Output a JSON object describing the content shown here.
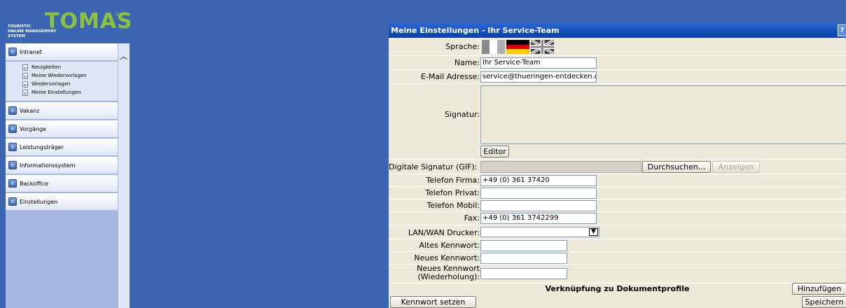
{
  "logo": {
    "wordmark": "TOMAS",
    "registered": "®",
    "tagline": "TOURISTIC\nONLINE MANAGEMENT\nSYSTEM"
  },
  "sidebar": {
    "scroll_up_icon": "chevron-up-icon",
    "sections": [
      {
        "label": "Intranet",
        "items": [
          "Neuigkeiten",
          "Meine Wiedervorlagen",
          "Wiedervorlagen",
          "Meine Einstellungen"
        ]
      },
      {
        "label": "Vakanz"
      },
      {
        "label": "Vorgänge"
      },
      {
        "label": "Leistungsträger"
      },
      {
        "label": "Informationssystem"
      },
      {
        "label": "Backoffice"
      },
      {
        "label": "Einstellungen"
      }
    ]
  },
  "dialog": {
    "title": "Meine Einstellungen - Ihr Service-Team",
    "help": "?",
    "language_label": "Sprache:",
    "languages": [
      "Italienisch",
      "Deutsch",
      "Englisch"
    ],
    "name_label": "Name:",
    "name_value": "Ihr Service-Team",
    "email_label": "E-Mail Adresse:",
    "email_value": "service@thueringen-entdecken.d",
    "signature_label": "Signatur:",
    "editor_button": "Editor",
    "digital_signature_label": "Digitale Signatur (GIF):",
    "browse_button": "Durchsuchen...",
    "show_button": "Anzeigen",
    "phone_company_label": "Telefon Firma:",
    "phone_company_value": "+49 (0) 361 37420",
    "phone_private_label": "Telefon Privat:",
    "phone_private_value": "",
    "phone_mobile_label": "Telefon Mobil:",
    "phone_mobile_value": "",
    "fax_label": "Fax:",
    "fax_value": "+49 (0) 361 3742299",
    "printer_label": "LAN/WAN Drucker:",
    "printer_value": "",
    "old_password_label": "Altes Kennwort:",
    "new_password_label": "Neues Kennwort:",
    "new_password_repeat_label": "Neues Kennwort\n(Wiederholung):",
    "doc_profile_heading": "Verknüpfung zu Dokumentprofile",
    "add_button": "Hinzufügen",
    "set_password_button": "Kennwort setzen",
    "save_button": "Speichern"
  },
  "colors": {
    "background": "#3b65b1",
    "sidebar": "#a4b6e0",
    "logo_green": "#8cc040",
    "titlebar": "#0a3fa8",
    "dialog_bg": "#ece9d8"
  }
}
